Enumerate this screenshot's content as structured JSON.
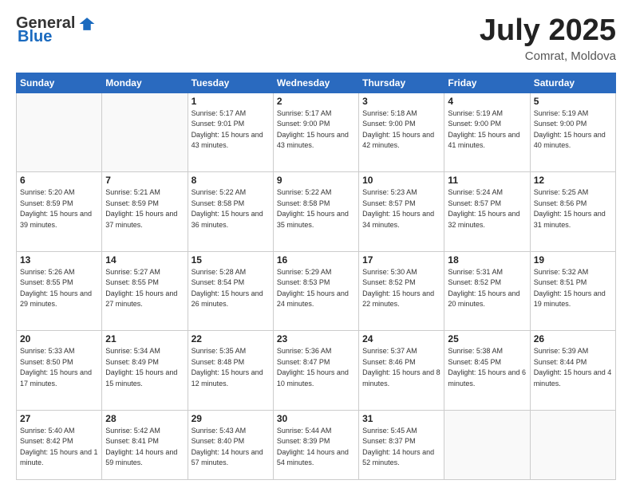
{
  "header": {
    "logo_general": "General",
    "logo_blue": "Blue",
    "month_year": "July 2025",
    "location": "Comrat, Moldova"
  },
  "weekdays": [
    "Sunday",
    "Monday",
    "Tuesday",
    "Wednesday",
    "Thursday",
    "Friday",
    "Saturday"
  ],
  "weeks": [
    [
      {
        "day": "",
        "sunrise": "",
        "sunset": "",
        "daylight": ""
      },
      {
        "day": "",
        "sunrise": "",
        "sunset": "",
        "daylight": ""
      },
      {
        "day": "1",
        "sunrise": "Sunrise: 5:17 AM",
        "sunset": "Sunset: 9:01 PM",
        "daylight": "Daylight: 15 hours and 43 minutes."
      },
      {
        "day": "2",
        "sunrise": "Sunrise: 5:17 AM",
        "sunset": "Sunset: 9:00 PM",
        "daylight": "Daylight: 15 hours and 43 minutes."
      },
      {
        "day": "3",
        "sunrise": "Sunrise: 5:18 AM",
        "sunset": "Sunset: 9:00 PM",
        "daylight": "Daylight: 15 hours and 42 minutes."
      },
      {
        "day": "4",
        "sunrise": "Sunrise: 5:19 AM",
        "sunset": "Sunset: 9:00 PM",
        "daylight": "Daylight: 15 hours and 41 minutes."
      },
      {
        "day": "5",
        "sunrise": "Sunrise: 5:19 AM",
        "sunset": "Sunset: 9:00 PM",
        "daylight": "Daylight: 15 hours and 40 minutes."
      }
    ],
    [
      {
        "day": "6",
        "sunrise": "Sunrise: 5:20 AM",
        "sunset": "Sunset: 8:59 PM",
        "daylight": "Daylight: 15 hours and 39 minutes."
      },
      {
        "day": "7",
        "sunrise": "Sunrise: 5:21 AM",
        "sunset": "Sunset: 8:59 PM",
        "daylight": "Daylight: 15 hours and 37 minutes."
      },
      {
        "day": "8",
        "sunrise": "Sunrise: 5:22 AM",
        "sunset": "Sunset: 8:58 PM",
        "daylight": "Daylight: 15 hours and 36 minutes."
      },
      {
        "day": "9",
        "sunrise": "Sunrise: 5:22 AM",
        "sunset": "Sunset: 8:58 PM",
        "daylight": "Daylight: 15 hours and 35 minutes."
      },
      {
        "day": "10",
        "sunrise": "Sunrise: 5:23 AM",
        "sunset": "Sunset: 8:57 PM",
        "daylight": "Daylight: 15 hours and 34 minutes."
      },
      {
        "day": "11",
        "sunrise": "Sunrise: 5:24 AM",
        "sunset": "Sunset: 8:57 PM",
        "daylight": "Daylight: 15 hours and 32 minutes."
      },
      {
        "day": "12",
        "sunrise": "Sunrise: 5:25 AM",
        "sunset": "Sunset: 8:56 PM",
        "daylight": "Daylight: 15 hours and 31 minutes."
      }
    ],
    [
      {
        "day": "13",
        "sunrise": "Sunrise: 5:26 AM",
        "sunset": "Sunset: 8:55 PM",
        "daylight": "Daylight: 15 hours and 29 minutes."
      },
      {
        "day": "14",
        "sunrise": "Sunrise: 5:27 AM",
        "sunset": "Sunset: 8:55 PM",
        "daylight": "Daylight: 15 hours and 27 minutes."
      },
      {
        "day": "15",
        "sunrise": "Sunrise: 5:28 AM",
        "sunset": "Sunset: 8:54 PM",
        "daylight": "Daylight: 15 hours and 26 minutes."
      },
      {
        "day": "16",
        "sunrise": "Sunrise: 5:29 AM",
        "sunset": "Sunset: 8:53 PM",
        "daylight": "Daylight: 15 hours and 24 minutes."
      },
      {
        "day": "17",
        "sunrise": "Sunrise: 5:30 AM",
        "sunset": "Sunset: 8:52 PM",
        "daylight": "Daylight: 15 hours and 22 minutes."
      },
      {
        "day": "18",
        "sunrise": "Sunrise: 5:31 AM",
        "sunset": "Sunset: 8:52 PM",
        "daylight": "Daylight: 15 hours and 20 minutes."
      },
      {
        "day": "19",
        "sunrise": "Sunrise: 5:32 AM",
        "sunset": "Sunset: 8:51 PM",
        "daylight": "Daylight: 15 hours and 19 minutes."
      }
    ],
    [
      {
        "day": "20",
        "sunrise": "Sunrise: 5:33 AM",
        "sunset": "Sunset: 8:50 PM",
        "daylight": "Daylight: 15 hours and 17 minutes."
      },
      {
        "day": "21",
        "sunrise": "Sunrise: 5:34 AM",
        "sunset": "Sunset: 8:49 PM",
        "daylight": "Daylight: 15 hours and 15 minutes."
      },
      {
        "day": "22",
        "sunrise": "Sunrise: 5:35 AM",
        "sunset": "Sunset: 8:48 PM",
        "daylight": "Daylight: 15 hours and 12 minutes."
      },
      {
        "day": "23",
        "sunrise": "Sunrise: 5:36 AM",
        "sunset": "Sunset: 8:47 PM",
        "daylight": "Daylight: 15 hours and 10 minutes."
      },
      {
        "day": "24",
        "sunrise": "Sunrise: 5:37 AM",
        "sunset": "Sunset: 8:46 PM",
        "daylight": "Daylight: 15 hours and 8 minutes."
      },
      {
        "day": "25",
        "sunrise": "Sunrise: 5:38 AM",
        "sunset": "Sunset: 8:45 PM",
        "daylight": "Daylight: 15 hours and 6 minutes."
      },
      {
        "day": "26",
        "sunrise": "Sunrise: 5:39 AM",
        "sunset": "Sunset: 8:44 PM",
        "daylight": "Daylight: 15 hours and 4 minutes."
      }
    ],
    [
      {
        "day": "27",
        "sunrise": "Sunrise: 5:40 AM",
        "sunset": "Sunset: 8:42 PM",
        "daylight": "Daylight: 15 hours and 1 minute."
      },
      {
        "day": "28",
        "sunrise": "Sunrise: 5:42 AM",
        "sunset": "Sunset: 8:41 PM",
        "daylight": "Daylight: 14 hours and 59 minutes."
      },
      {
        "day": "29",
        "sunrise": "Sunrise: 5:43 AM",
        "sunset": "Sunset: 8:40 PM",
        "daylight": "Daylight: 14 hours and 57 minutes."
      },
      {
        "day": "30",
        "sunrise": "Sunrise: 5:44 AM",
        "sunset": "Sunset: 8:39 PM",
        "daylight": "Daylight: 14 hours and 54 minutes."
      },
      {
        "day": "31",
        "sunrise": "Sunrise: 5:45 AM",
        "sunset": "Sunset: 8:37 PM",
        "daylight": "Daylight: 14 hours and 52 minutes."
      },
      {
        "day": "",
        "sunrise": "",
        "sunset": "",
        "daylight": ""
      },
      {
        "day": "",
        "sunrise": "",
        "sunset": "",
        "daylight": ""
      }
    ]
  ]
}
